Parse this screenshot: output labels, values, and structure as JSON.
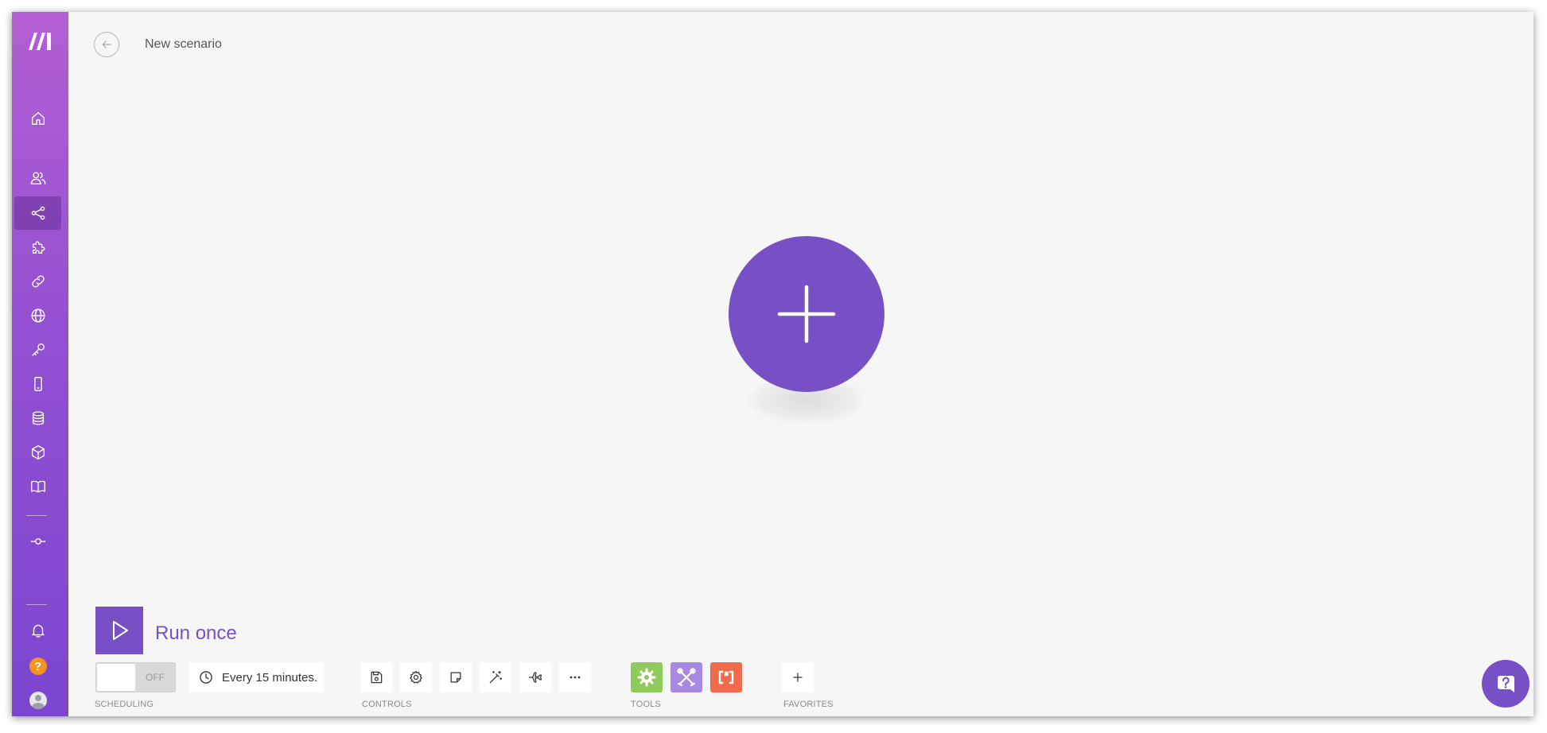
{
  "scenario": {
    "title": "New scenario"
  },
  "sidebar": {
    "items": [
      {
        "name": "home",
        "icon": "home-icon"
      },
      {
        "name": "team",
        "icon": "users-icon"
      },
      {
        "name": "scenarios",
        "icon": "share-icon",
        "active": true
      },
      {
        "name": "templates",
        "icon": "puzzle-icon"
      },
      {
        "name": "connections",
        "icon": "link-icon"
      },
      {
        "name": "webhooks",
        "icon": "globe-icon"
      },
      {
        "name": "keys",
        "icon": "key-icon"
      },
      {
        "name": "devices",
        "icon": "mobile-icon"
      },
      {
        "name": "data-stores",
        "icon": "database-icon"
      },
      {
        "name": "data-structures",
        "icon": "cube-icon"
      },
      {
        "name": "docs",
        "icon": "book-icon"
      },
      {
        "name": "more",
        "icon": "commit-icon"
      },
      {
        "name": "notifications",
        "icon": "bell-icon"
      },
      {
        "name": "help",
        "icon": "help-icon",
        "glyph": "?"
      },
      {
        "name": "profile",
        "icon": "avatar-icon"
      }
    ]
  },
  "run": {
    "label": "Run once"
  },
  "scheduling": {
    "toggle_label": "OFF",
    "interval": "Every 15 minutes.",
    "section_label": "SCHEDULING"
  },
  "controls": {
    "section_label": "CONTROLS"
  },
  "tools": {
    "section_label": "TOOLS",
    "colors": {
      "flow": "#8fcb5a",
      "tools": "#a889e2",
      "text": "#f26a4c"
    }
  },
  "favorites": {
    "section_label": "FAVORITES"
  },
  "colors": {
    "accent": "#7650c4",
    "sidebar_top": "#b45ed3",
    "sidebar_bottom": "#7b46cf"
  }
}
